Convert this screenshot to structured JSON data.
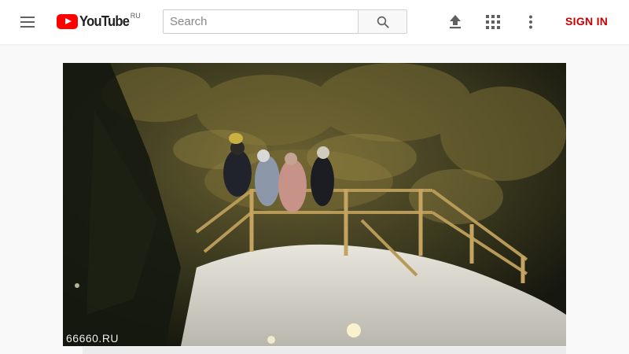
{
  "header": {
    "logo_text": "YouTube",
    "logo_region": "RU",
    "search": {
      "placeholder": "Search",
      "value": ""
    },
    "signin_label": "SIGN IN",
    "icons": [
      "menu-icon",
      "search-icon",
      "upload-icon",
      "apps-grid-icon",
      "more-vert-icon"
    ]
  },
  "player": {
    "watermark": "66660.RU"
  },
  "colors": {
    "brand_red": "#ff0000",
    "signin_red": "#cc0000",
    "background": "#f9f9f9"
  }
}
